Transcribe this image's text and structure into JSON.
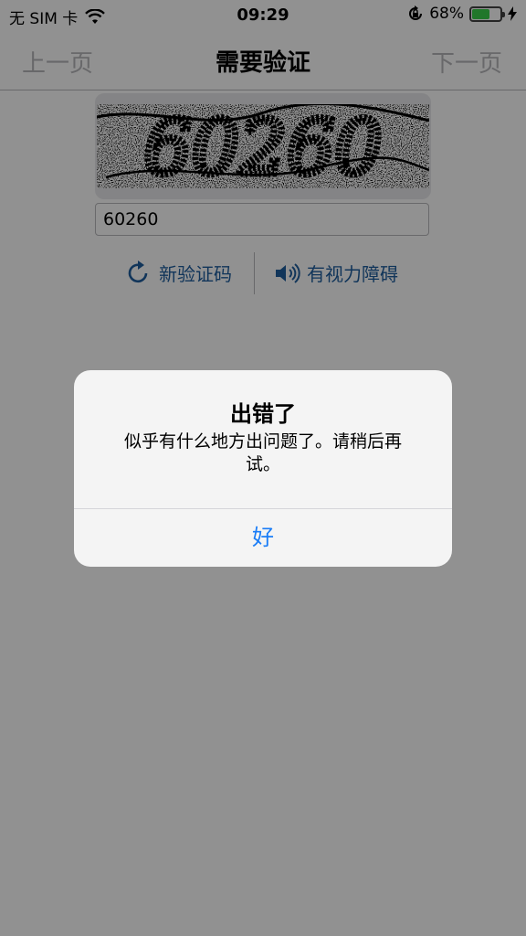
{
  "status_bar": {
    "carrier": "无 SIM 卡",
    "time": "09:29",
    "battery_percent": "68%",
    "battery_level": 0.68,
    "icons": [
      "wifi-icon",
      "rotation-lock-icon",
      "battery-icon",
      "charging-bolt-icon"
    ]
  },
  "nav": {
    "prev_label": "上一页",
    "title": "需要验证",
    "next_label": "下一页"
  },
  "captcha": {
    "image_text": "60260",
    "input_value": "60260",
    "refresh_label": "新验证码",
    "audio_label": "有视力障碍"
  },
  "alert": {
    "title": "出错了",
    "message": "似乎有什么地方出问题了。请稍后再试。",
    "ok_label": "好"
  },
  "colors": {
    "accent_blue": "#1a7df7",
    "link_blue": "#1f5e9e",
    "nav_disabled": "#b7b7bb",
    "battery_green": "#3bd14a"
  }
}
